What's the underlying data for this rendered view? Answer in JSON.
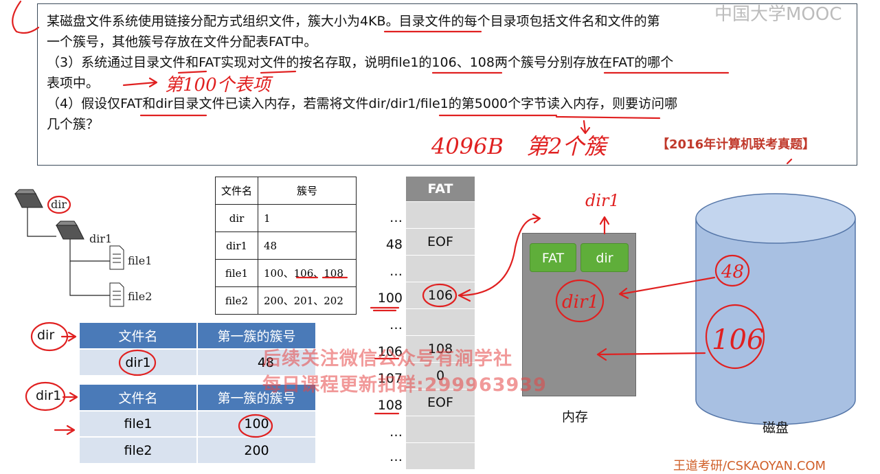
{
  "watermark_top": "中国大学MOOC",
  "question": {
    "line1": "某磁盘文件系统使用链接分配方式组织文件，簇大小为4KB。目录文件的每个目录项包括文件名和文件的第",
    "line2": "一个簇号，其他簇号存放在文件分配表FAT中。",
    "line3": "（3）系统通过目录文件和FAT实现对文件的按名存取，说明file1的106、108两个簇号分别存放在FAT的哪个",
    "line4": "表项中。",
    "line5": "（4）假设仅FAT和dir目录文件已读入内存，若需将文件dir/dir1/file1的第5000个字节读入内存，则要访问哪",
    "line6": "几个簇？"
  },
  "source_label": "【2016年计算机联考真题】",
  "tree": {
    "root": "dir",
    "child": "dir1",
    "files": [
      "file1",
      "file2"
    ]
  },
  "dir_table": {
    "headers": [
      "文件名",
      "簇号"
    ],
    "rows": [
      [
        "dir",
        "1"
      ],
      [
        "dir1",
        "48"
      ],
      [
        "file1",
        "100、106、108"
      ],
      [
        "file2",
        "200、201、202"
      ]
    ]
  },
  "dir_entries": {
    "label": "dir",
    "headers": [
      "文件名",
      "第一簇的簇号"
    ],
    "rows": [
      [
        "dir1",
        "48"
      ]
    ]
  },
  "dir1_entries": {
    "label": "dir1",
    "headers": [
      "文件名",
      "第一簇的簇号"
    ],
    "rows": [
      [
        "file1",
        "100"
      ],
      [
        "file2",
        "200"
      ]
    ]
  },
  "fat": {
    "title": "FAT",
    "index": [
      "…",
      "48",
      "…",
      "100",
      "…",
      "106",
      "107",
      "108",
      "…",
      "…"
    ],
    "values": [
      "",
      "EOF",
      "",
      "106",
      "",
      "108",
      "0",
      "EOF",
      "",
      ""
    ]
  },
  "memory": {
    "label": "内存",
    "blocks": [
      "FAT",
      "dir"
    ]
  },
  "disk": {
    "label": "磁盘"
  },
  "annotations": {
    "answer3": "第100个表项",
    "answer4_bytes": "4096B",
    "answer4_cluster": "第2个簇",
    "dir1_note": "dir1",
    "mem_dir1": "dir1",
    "disk_48": "48",
    "disk_106": "106"
  },
  "overlay_watermark": {
    "line1": "后续关注微信公众号有涧学社",
    "line2": "每日课程更新扣群:299963939"
  },
  "footer": "王道考研/CSKAOYAN.COM"
}
